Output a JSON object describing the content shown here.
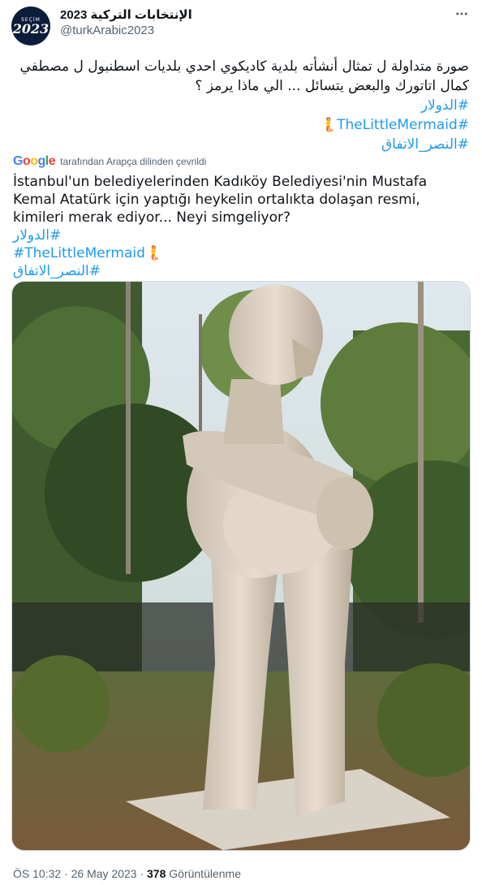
{
  "author": {
    "display_name": "الإنتخابات التركية 2023",
    "handle": "@turkArabic2023",
    "avatar_small_text": "SEÇİM",
    "avatar_big_text": "2023"
  },
  "tweet": {
    "text_ar": "صورة متداولة ل تمثال أنشأته بلدية كاديكوي احدي بلديات اسطنبول ل مصطفي كمال اتاتورك والبعض يتسائل ... الي ماذا يرمز ؟",
    "hashtags": [
      "#الدولار",
      "#TheLittleMermaid🧜",
      "#النصر_الاتفاق"
    ]
  },
  "translation": {
    "provider": "Google",
    "label": "tarafından Arapça dilinden çevrildi",
    "text": "İstanbul'un belediyelerinden Kadıköy Belediyesi'nin Mustafa Kemal Atatürk için yaptığı heykelin ortalıkta dolaşan resmi, kimileri merak ediyor... Neyi simgeliyor?",
    "hashtags": [
      "#الدولار",
      "#TheLittleMermaid🧜",
      "#النصر_الاتفاق"
    ]
  },
  "meta": {
    "time": "ÖS 10:32",
    "date": "26 May 2023",
    "separator": "·",
    "views_count": "378",
    "views_label": "Görüntülenme"
  },
  "colors": {
    "link": "#1d9bf0",
    "secondary_text": "#536471",
    "primary_text": "#0f1419"
  },
  "icons": [
    "more-icon",
    "google-logo"
  ]
}
